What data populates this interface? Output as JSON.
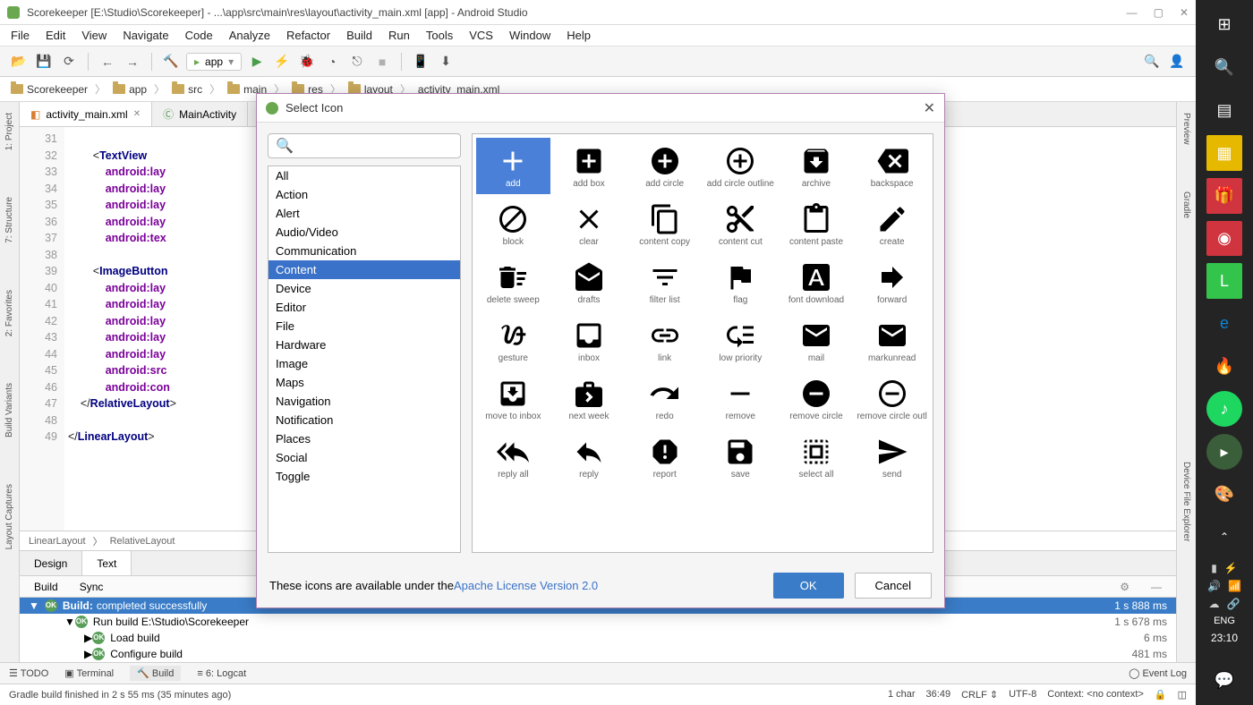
{
  "titlebar": {
    "text": "Scorekeeper [E:\\Studio\\Scorekeeper] - ...\\app\\src\\main\\res\\layout\\activity_main.xml [app] - Android Studio"
  },
  "menu": {
    "file": "File",
    "edit": "Edit",
    "view": "View",
    "navigate": "Navigate",
    "code": "Code",
    "analyze": "Analyze",
    "refactor": "Refactor",
    "build": "Build",
    "run": "Run",
    "tools": "Tools",
    "vcs": "VCS",
    "window": "Window",
    "help": "Help"
  },
  "run_config": {
    "label": "app"
  },
  "breadcrumbs": [
    "Scorekeeper",
    "app",
    "src",
    "main",
    "res",
    "layout",
    "activity_main.xml"
  ],
  "tabs": {
    "t0": "activity_main.xml",
    "t1": "MainActivity"
  },
  "design_tabs": {
    "design": "Design",
    "text": "Text"
  },
  "buildsync": {
    "build": "Build",
    "sync": "Sync"
  },
  "code": {
    "lines_start": 31,
    "breadcrumb1": "LinearLayout",
    "breadcrumb2": "RelativeLayout",
    "text": "\n        <TextView\n            android:lay\n            android:lay\n            android:lay\n            android:lay\n            android:tex\n\n        <ImageButton\n            android:lay\n            android:lay\n            android:lay\n            android:lay\n            android:lay\n            android:src\n            android:con\n    </RelativeLayout>\n\n</LinearLayout>"
  },
  "build": {
    "header": "Build:",
    "header2": "completed successfully",
    "time0": "1 s 888 ms",
    "row1": "Run build  E:\\Studio\\Scorekeeper",
    "t1": "1 s 678 ms",
    "row2": "Load build",
    "t2": "6 ms",
    "row3": "Configure build",
    "t3": "481 ms"
  },
  "bottombar": {
    "todo": "TODO",
    "terminal": "Terminal",
    "build": "Build",
    "logcat": "Logcat",
    "eventlog": "Event Log"
  },
  "status": {
    "msg": "Gradle build finished in 2 s 55 ms (35 minutes ago)",
    "chars": "1 char",
    "pos": "36:49",
    "crlf": "CRLF",
    "enc": "UTF-8",
    "ctx": "Context: <no context>"
  },
  "dialog": {
    "title": "Select Icon",
    "categories": [
      "All",
      "Action",
      "Alert",
      "Audio/Video",
      "Communication",
      "Content",
      "Device",
      "Editor",
      "File",
      "Hardware",
      "Image",
      "Maps",
      "Navigation",
      "Notification",
      "Places",
      "Social",
      "Toggle"
    ],
    "selected_category": "Content",
    "license_text": "These icons are available under the ",
    "license_link": "Apache License Version 2.0",
    "ok": "OK",
    "cancel": "Cancel",
    "icons": [
      {
        "n": "add",
        "sel": true
      },
      {
        "n": "add box"
      },
      {
        "n": "add circle"
      },
      {
        "n": "add circle outline"
      },
      {
        "n": "archive"
      },
      {
        "n": "backspace"
      },
      {
        "n": "block"
      },
      {
        "n": "clear"
      },
      {
        "n": "content copy"
      },
      {
        "n": "content cut"
      },
      {
        "n": "content paste"
      },
      {
        "n": "create"
      },
      {
        "n": "delete sweep"
      },
      {
        "n": "drafts"
      },
      {
        "n": "filter list"
      },
      {
        "n": "flag"
      },
      {
        "n": "font download"
      },
      {
        "n": "forward"
      },
      {
        "n": "gesture"
      },
      {
        "n": "inbox"
      },
      {
        "n": "link"
      },
      {
        "n": "low priority"
      },
      {
        "n": "mail"
      },
      {
        "n": "markunread"
      },
      {
        "n": "move to inbox"
      },
      {
        "n": "next week"
      },
      {
        "n": "redo"
      },
      {
        "n": "remove"
      },
      {
        "n": "remove circle"
      },
      {
        "n": "remove circle outl"
      },
      {
        "n": "reply all"
      },
      {
        "n": "reply"
      },
      {
        "n": "report"
      },
      {
        "n": "save"
      },
      {
        "n": "select all"
      },
      {
        "n": "send"
      }
    ]
  },
  "taskbar": {
    "lang": "ENG",
    "time": "23:10"
  },
  "left_panels": {
    "project": "1: Project",
    "structure": "7: Structure",
    "favorites": "2: Favorites",
    "build": "Build Variants",
    "capture": "Layout Captures"
  },
  "right_panels": {
    "preview": "Preview",
    "gradle": "Gradle",
    "explorer": "Device File Explorer"
  }
}
